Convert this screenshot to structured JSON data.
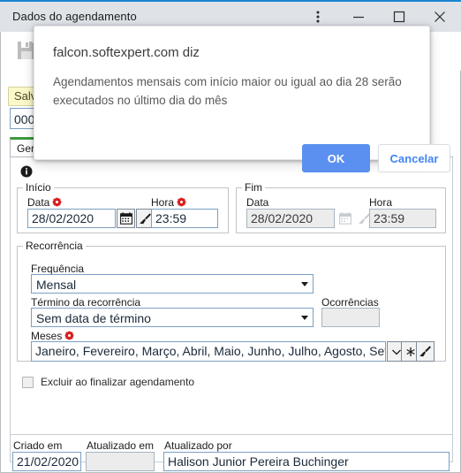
{
  "window": {
    "title": "Dados do agendamento",
    "controls": {
      "menu": "kebab-menu-icon",
      "minimize": "minimize-icon",
      "maximize": "maximize-icon",
      "close": "close-icon"
    },
    "accent_color": "#1a86d0",
    "titlebar_color": "#dfe3e8"
  },
  "toolbar": {
    "save_icon": "save-floppy-icon",
    "save_tooltip": "Salvar"
  },
  "form": {
    "code_value": "000",
    "tab_label": "Geral",
    "tab_accent_color": "#3e9b3e",
    "info_icon": "info-icon",
    "start_group": {
      "legend": "Início",
      "date_label": "Data",
      "date_value": "28/02/2020",
      "time_label": "Hora",
      "time_value": "23:59",
      "calendar_icon": "calendar-icon",
      "clear_icon": "eraser-brush-icon",
      "required_marker": "required-asterisk-icon"
    },
    "end_group": {
      "legend": "Fim",
      "date_label": "Data",
      "date_value": "28/02/2020",
      "time_label": "Hora",
      "time_value": "23:59",
      "calendar_icon": "calendar-icon",
      "clear_icon": "eraser-brush-icon"
    },
    "recurrence": {
      "legend": "Recorrência",
      "frequency_label": "Frequência",
      "frequency_value": "Mensal",
      "end_label": "Término da recorrência",
      "end_value": "Sem data de término",
      "occurrences_label": "Ocorrências",
      "occurrences_value": "",
      "months_label": "Meses",
      "months_value": "Janeiro, Fevereiro, Março, Abril, Maio, Junho, Julho, Agosto, Setembro",
      "chevron_icon": "chevron-down-icon",
      "asterisk_icon": "asterisk-icon",
      "clear_icon": "eraser-brush-icon",
      "required_marker": "required-asterisk-icon"
    },
    "delete_checkbox_label": "Excluir ao finalizar agendamento",
    "delete_checkbox_checked": false
  },
  "footer": {
    "created_label": "Criado em",
    "created_value": "21/02/2020",
    "updated_label": "Atualizado em",
    "updated_value": "",
    "updated_by_label": "Atualizado por",
    "updated_by_value": "Halison Junior Pereira Buchinger"
  },
  "dialog": {
    "origin": "falcon.softexpert.com diz",
    "message": "Agendamentos mensais com início maior ou igual ao dia 28 serão executados no último dia do mês",
    "ok_label": "OK",
    "cancel_label": "Cancelar",
    "ok_color": "#5b90f0",
    "cancel_text_color": "#4285f4"
  }
}
